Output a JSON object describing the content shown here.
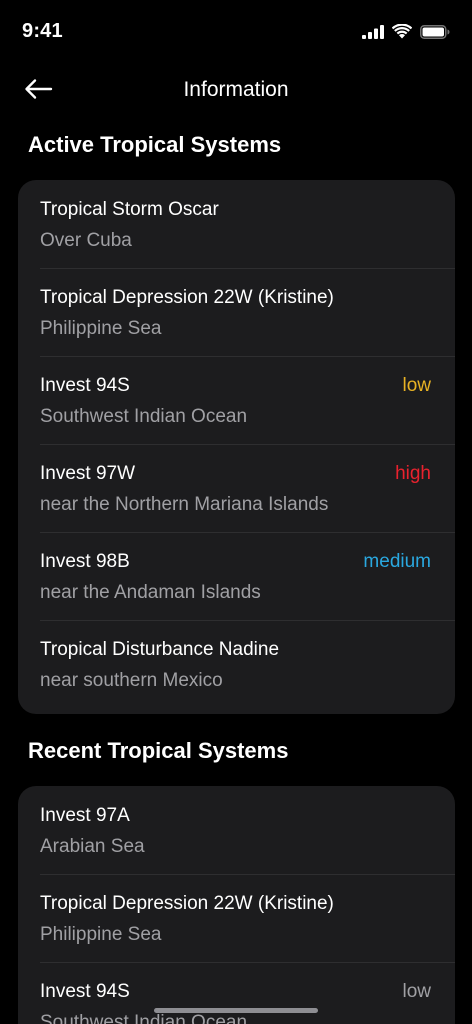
{
  "status_bar": {
    "time": "9:41"
  },
  "header": {
    "title": "Information"
  },
  "active": {
    "title": "Active Tropical Systems",
    "items": [
      {
        "name": "Tropical Storm Oscar",
        "location": "Over Cuba",
        "badge": "",
        "badge_color": ""
      },
      {
        "name": "Tropical Depression 22W (Kristine)",
        "location": "Philippine Sea",
        "badge": "",
        "badge_color": ""
      },
      {
        "name": "Invest 94S",
        "location": "Southwest Indian Ocean",
        "badge": "low",
        "badge_color": "#e8b224"
      },
      {
        "name": "Invest 97W",
        "location": "near the Northern Mariana Islands",
        "badge": "high",
        "badge_color": "#e8222e"
      },
      {
        "name": "Invest 98B",
        "location": "near the Andaman Islands",
        "badge": "medium",
        "badge_color": "#2aa8e0"
      },
      {
        "name": "Tropical Disturbance Nadine",
        "location": "near southern Mexico",
        "badge": "",
        "badge_color": ""
      }
    ]
  },
  "recent": {
    "title": "Recent Tropical Systems",
    "items": [
      {
        "name": "Invest 97A",
        "location": "Arabian Sea",
        "badge": "",
        "badge_color": ""
      },
      {
        "name": "Tropical Depression 22W (Kristine)",
        "location": "Philippine Sea",
        "badge": "",
        "badge_color": ""
      },
      {
        "name": "Invest 94S",
        "location": "Southwest Indian Ocean",
        "badge": "low",
        "badge_color": "#a0a0a4"
      }
    ]
  },
  "icons": {
    "signal": "cellular-signal-icon",
    "wifi": "wifi-icon",
    "battery": "battery-icon",
    "back": "back-arrow-icon"
  }
}
